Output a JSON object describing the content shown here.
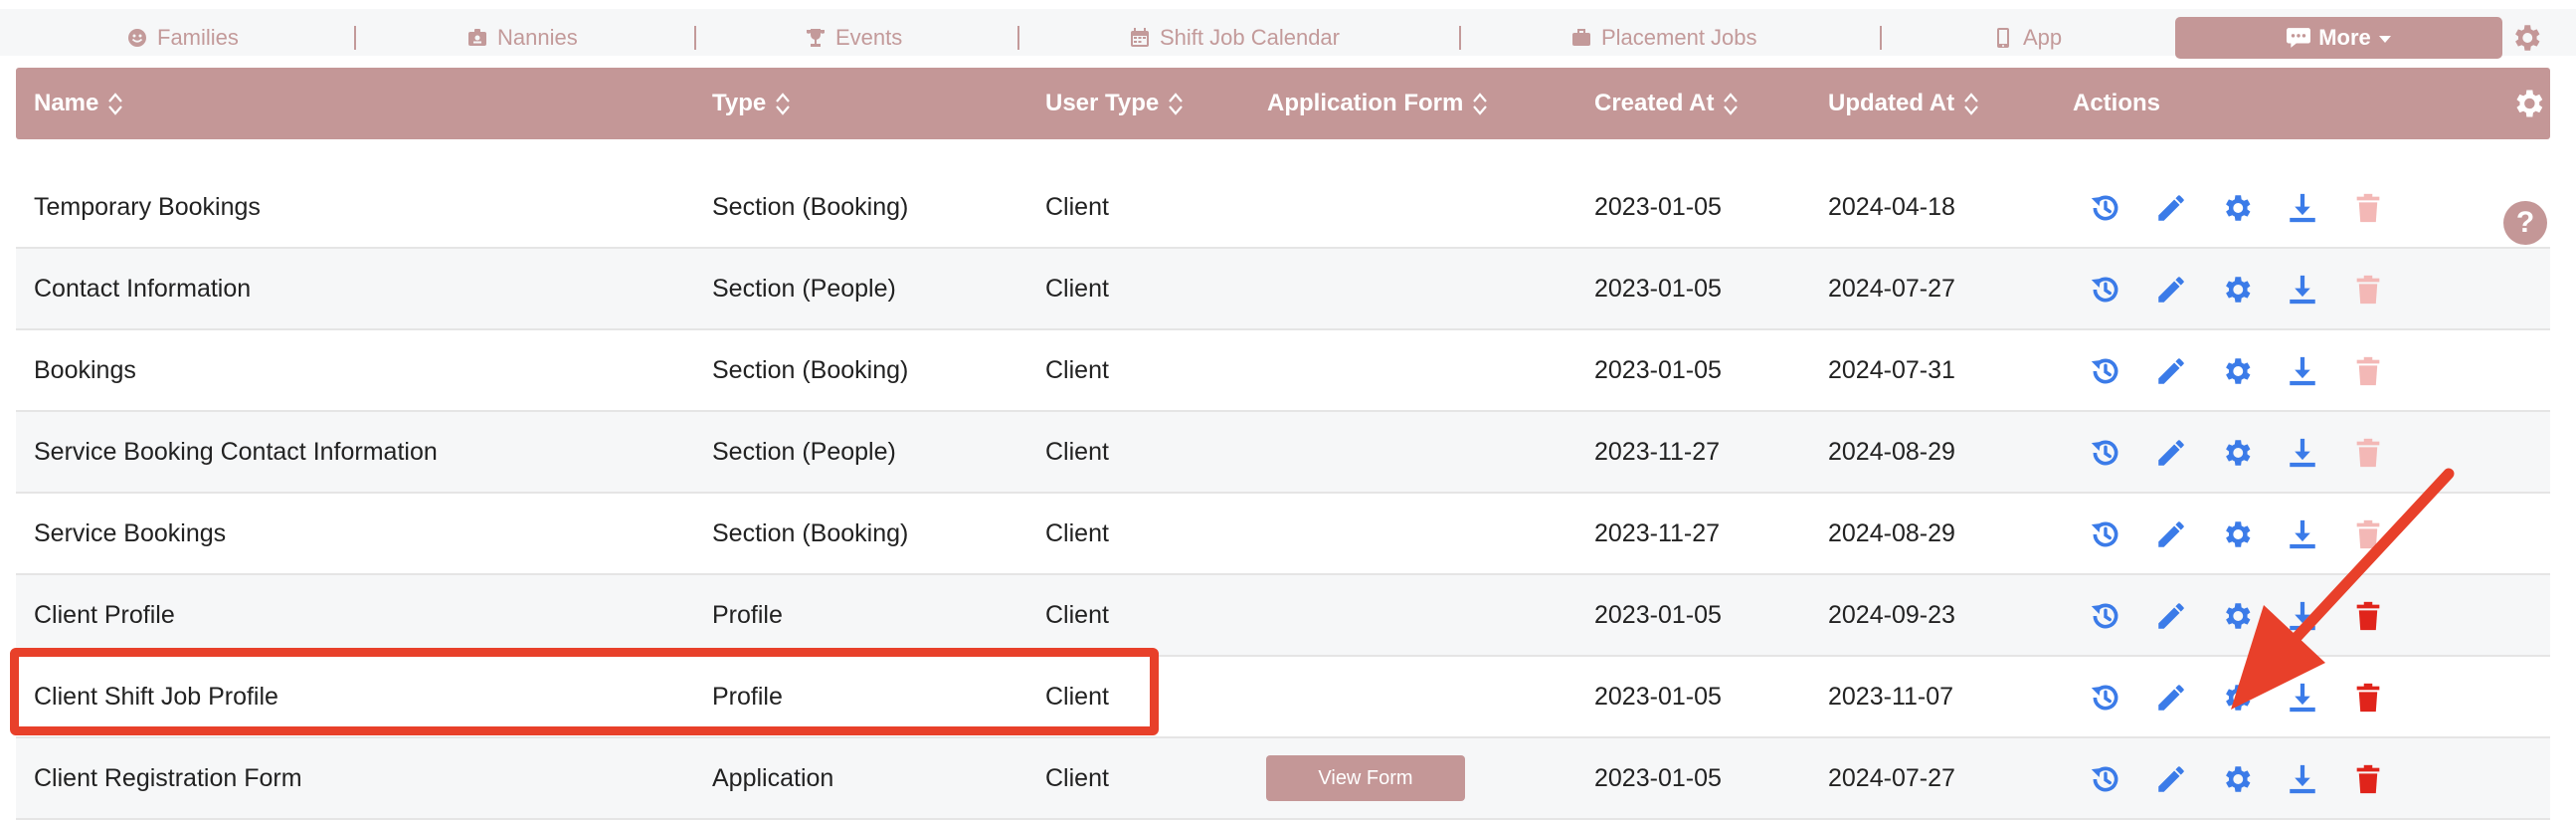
{
  "nav": {
    "items": [
      {
        "label": "Families",
        "icon": "smile-icon"
      },
      {
        "label": "Nannies",
        "icon": "id-badge-icon"
      },
      {
        "label": "Events",
        "icon": "trophy-icon"
      },
      {
        "label": "Shift Job Calendar",
        "icon": "calendar-icon"
      },
      {
        "label": "Placement Jobs",
        "icon": "briefcase-icon"
      },
      {
        "label": "App",
        "icon": "phone-icon"
      }
    ],
    "more_label": "More"
  },
  "table": {
    "headers": {
      "name": "Name",
      "type": "Type",
      "user_type": "User Type",
      "application_form": "Application Form",
      "created_at": "Created At",
      "updated_at": "Updated At",
      "actions": "Actions"
    },
    "view_form_label": "View Form",
    "help_label": "?",
    "rows": [
      {
        "name": "Temporary Bookings",
        "type": "Section (Booking)",
        "user_type": "Client",
        "created": "2023-01-05",
        "updated": "2024-04-18",
        "delete_enabled": false
      },
      {
        "name": "Contact Information",
        "type": "Section (People)",
        "user_type": "Client",
        "created": "2023-01-05",
        "updated": "2024-07-27",
        "delete_enabled": false
      },
      {
        "name": "Bookings",
        "type": "Section (Booking)",
        "user_type": "Client",
        "created": "2023-01-05",
        "updated": "2024-07-31",
        "delete_enabled": false
      },
      {
        "name": "Service Booking Contact Information",
        "type": "Section (People)",
        "user_type": "Client",
        "created": "2023-11-27",
        "updated": "2024-08-29",
        "delete_enabled": false
      },
      {
        "name": "Service Bookings",
        "type": "Section (Booking)",
        "user_type": "Client",
        "created": "2023-11-27",
        "updated": "2024-08-29",
        "delete_enabled": false
      },
      {
        "name": "Client Profile",
        "type": "Profile",
        "user_type": "Client",
        "created": "2023-01-05",
        "updated": "2024-09-23",
        "delete_enabled": true
      },
      {
        "name": "Client Shift Job Profile",
        "type": "Profile",
        "user_type": "Client",
        "created": "2023-01-05",
        "updated": "2023-11-07",
        "delete_enabled": true
      },
      {
        "name": "Client Registration Form",
        "type": "Application",
        "user_type": "Client",
        "created": "2023-01-05",
        "updated": "2024-07-27",
        "delete_enabled": true,
        "has_form": true
      }
    ]
  },
  "colors": {
    "brand": "#c49797",
    "action_blue": "#3b7be8",
    "delete_red": "#e0241b",
    "delete_disabled": "#f3b8b6",
    "annotation": "#e8402a"
  }
}
